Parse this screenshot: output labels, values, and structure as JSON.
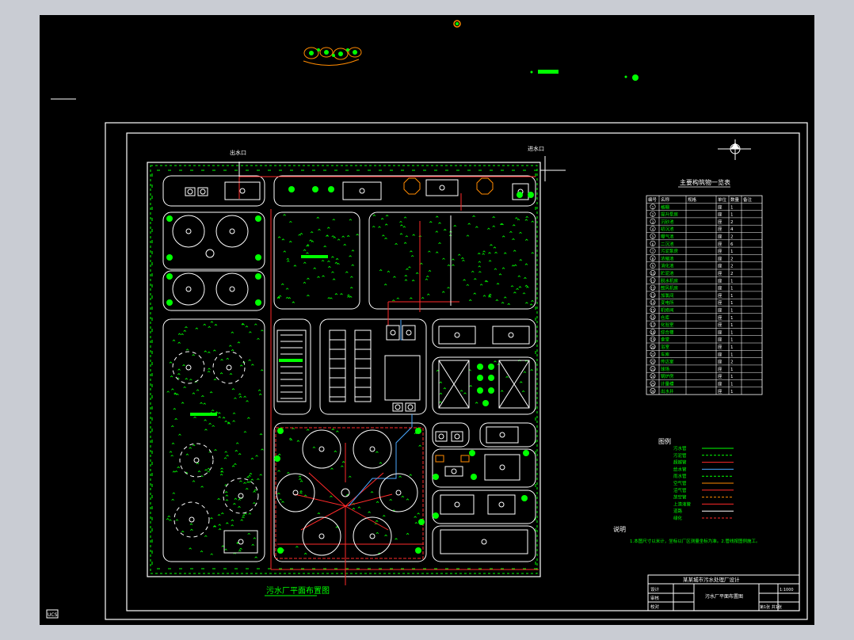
{
  "colors": {
    "background": "#000000",
    "frame": "#ffffff",
    "plant": "#00ff00",
    "pipe_red": "#ff2a2a",
    "pipe_blue": "#4aa8ff",
    "orange": "#ff8a00"
  },
  "plan": {
    "title": "污水厂平面布置图",
    "north_label": "北",
    "north_arrow_icon": "north-arrow-icon",
    "gate_labels": [
      "出水口",
      "进水口"
    ]
  },
  "structure_table": {
    "title": "主要构筑物一览表",
    "headers": [
      "编号",
      "名称",
      "规格",
      "单位",
      "数量",
      "备注"
    ],
    "rows": [
      [
        "1",
        "格栅",
        "",
        "座",
        "1",
        ""
      ],
      [
        "2",
        "提升泵房",
        "",
        "座",
        "1",
        ""
      ],
      [
        "3",
        "沉砂池",
        "",
        "座",
        "2",
        ""
      ],
      [
        "4",
        "初沉池",
        "",
        "座",
        "4",
        ""
      ],
      [
        "5",
        "曝气池",
        "",
        "座",
        "2",
        ""
      ],
      [
        "6",
        "二沉池",
        "",
        "座",
        "6",
        ""
      ],
      [
        "7",
        "污泥泵房",
        "",
        "座",
        "1",
        ""
      ],
      [
        "8",
        "浓缩池",
        "",
        "座",
        "2",
        ""
      ],
      [
        "9",
        "消化池",
        "",
        "座",
        "2",
        ""
      ],
      [
        "10",
        "贮泥池",
        "",
        "座",
        "2",
        ""
      ],
      [
        "11",
        "脱水机房",
        "",
        "座",
        "1",
        ""
      ],
      [
        "12",
        "鼓风机房",
        "",
        "座",
        "1",
        ""
      ],
      [
        "13",
        "加氯间",
        "",
        "座",
        "1",
        ""
      ],
      [
        "14",
        "变电所",
        "",
        "座",
        "1",
        ""
      ],
      [
        "15",
        "机修间",
        "",
        "座",
        "1",
        ""
      ],
      [
        "16",
        "仓库",
        "",
        "座",
        "1",
        ""
      ],
      [
        "17",
        "化验室",
        "",
        "座",
        "1",
        ""
      ],
      [
        "18",
        "综合楼",
        "",
        "座",
        "1",
        ""
      ],
      [
        "19",
        "食堂",
        "",
        "座",
        "1",
        ""
      ],
      [
        "20",
        "浴室",
        "",
        "座",
        "1",
        ""
      ],
      [
        "21",
        "车库",
        "",
        "座",
        "1",
        ""
      ],
      [
        "22",
        "传达室",
        "",
        "座",
        "2",
        ""
      ],
      [
        "23",
        "球场",
        "",
        "座",
        "1",
        ""
      ],
      [
        "24",
        "锅炉房",
        "",
        "座",
        "1",
        ""
      ],
      [
        "25",
        "计量槽",
        "",
        "座",
        "1",
        ""
      ],
      [
        "26",
        "出水井",
        "",
        "座",
        "1",
        ""
      ]
    ]
  },
  "legend": {
    "title": "图例",
    "items": [
      {
        "label": "污水管",
        "color": "#00ff00"
      },
      {
        "label": "污泥管",
        "color": "#00ff00"
      },
      {
        "label": "超越管",
        "color": "#ff2a2a"
      },
      {
        "label": "给水管",
        "color": "#4aa8ff"
      },
      {
        "label": "雨水管",
        "color": "#00ff00"
      },
      {
        "label": "空气管",
        "color": "#ff8a00"
      },
      {
        "label": "沼气管",
        "color": "#ff2a2a"
      },
      {
        "label": "放空管",
        "color": "#ff8a00"
      },
      {
        "label": "上清液管",
        "color": "#ff2a2a"
      },
      {
        "label": "道路",
        "color": "#ffffff"
      },
      {
        "label": "绿化",
        "color": "#ff2a2a"
      }
    ]
  },
  "notes": {
    "title": "说明",
    "text": "1.本图尺寸以米计，坐标以厂区测量坐标为准。2.管线按图例施工。"
  },
  "title_block": {
    "company": "某某城市污水处理厂设计",
    "drawing_name": "污水厂平面布置图",
    "labels": [
      "设计",
      "审核",
      "校对"
    ],
    "scale": "1:1000",
    "sheet": "第1张 共1张"
  },
  "ucs_label": "UCS"
}
